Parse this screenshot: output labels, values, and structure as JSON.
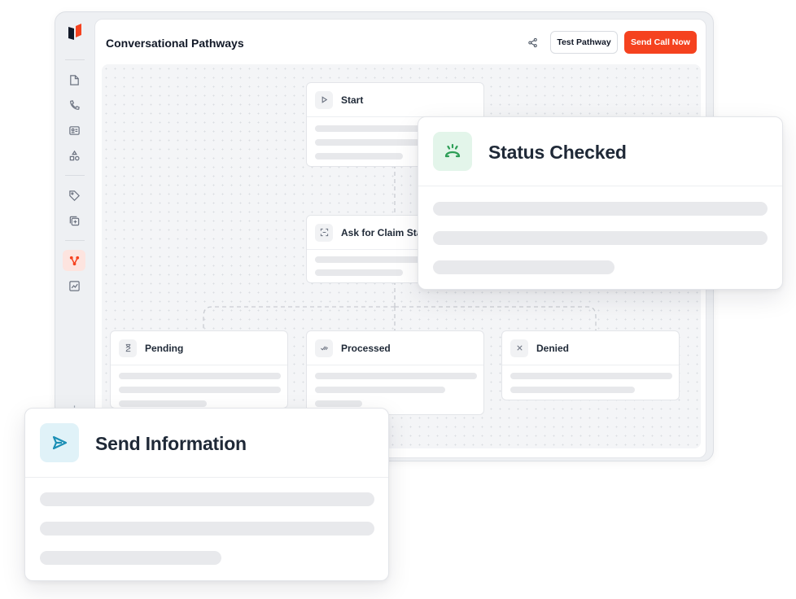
{
  "header": {
    "title": "Conversational Pathways",
    "test_button": "Test Pathway",
    "send_button": "Send Call Now"
  },
  "sidebar": {
    "items": [
      {
        "icon": "document-add-icon"
      },
      {
        "icon": "phone-icon"
      },
      {
        "icon": "contact-card-icon"
      },
      {
        "icon": "shapes-icon"
      },
      {
        "icon": "tag-icon"
      },
      {
        "icon": "copy-plus-icon"
      },
      {
        "icon": "pathway-icon",
        "active": true
      },
      {
        "icon": "analytics-icon"
      }
    ]
  },
  "nodes": {
    "start": "Start",
    "ask": "Ask for Claim Status",
    "pending": "Pending",
    "processed": "Processed",
    "denied": "Denied"
  },
  "cards": {
    "status_checked": "Status Checked",
    "send_information": "Send Information"
  },
  "colors": {
    "accent": "#f5421f",
    "status_icon_bg": "#e3f5ea",
    "status_icon": "#2e9e57",
    "send_icon_bg": "#e0f2f8",
    "send_icon": "#1c8fb5"
  }
}
